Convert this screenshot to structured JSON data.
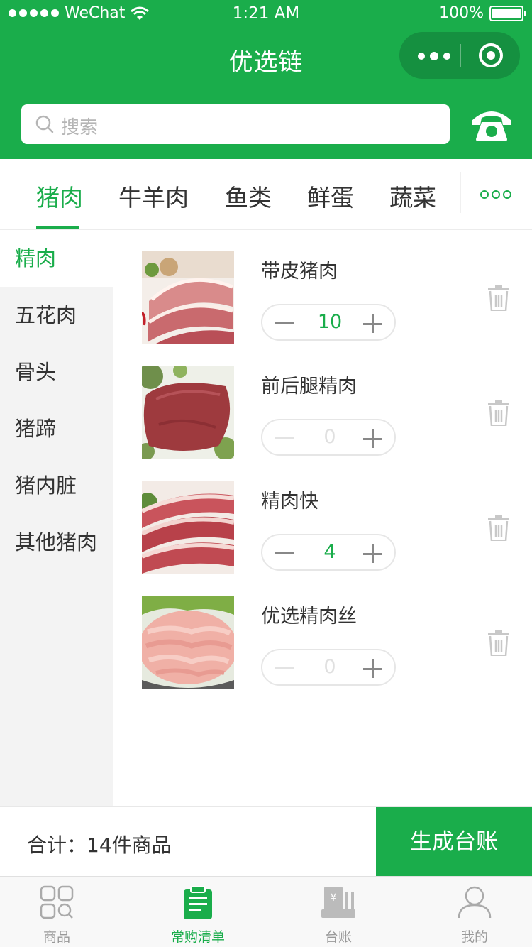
{
  "status_bar": {
    "carrier": "WeChat",
    "time": "1:21 AM",
    "battery": "100%"
  },
  "nav": {
    "title": "优选链"
  },
  "search": {
    "placeholder": "搜索"
  },
  "categories": {
    "items": [
      "猪肉",
      "牛羊肉",
      "鱼类",
      "鲜蛋",
      "蔬菜"
    ],
    "active_index": 0
  },
  "subcategories": {
    "items": [
      "精肉",
      "五花肉",
      "骨头",
      "猪蹄",
      "猪内脏",
      "其他猪肉"
    ],
    "active_index": 0
  },
  "products": [
    {
      "name": "带皮猪肉",
      "qty": "10",
      "image": "pork-with-skin"
    },
    {
      "name": "前后腿精肉",
      "qty": "0",
      "image": "lean-leg-pork"
    },
    {
      "name": "精肉快",
      "qty": "4",
      "image": "lean-pork-chunks"
    },
    {
      "name": "优选精肉丝",
      "qty": "0",
      "image": "shredded-lean-pork"
    }
  ],
  "footer": {
    "total_label": "合计：14件商品",
    "generate_button": "生成台账"
  },
  "tabbar": {
    "items": [
      {
        "label": "商品",
        "icon": "grid-search-icon"
      },
      {
        "label": "常购清单",
        "icon": "clipboard-list-icon"
      },
      {
        "label": "台账",
        "icon": "ledger-icon"
      },
      {
        "label": "我的",
        "icon": "person-icon"
      }
    ],
    "active_index": 1
  },
  "colors": {
    "brand": "#1aad4b",
    "brand_dark": "#159040",
    "muted": "#999999"
  }
}
